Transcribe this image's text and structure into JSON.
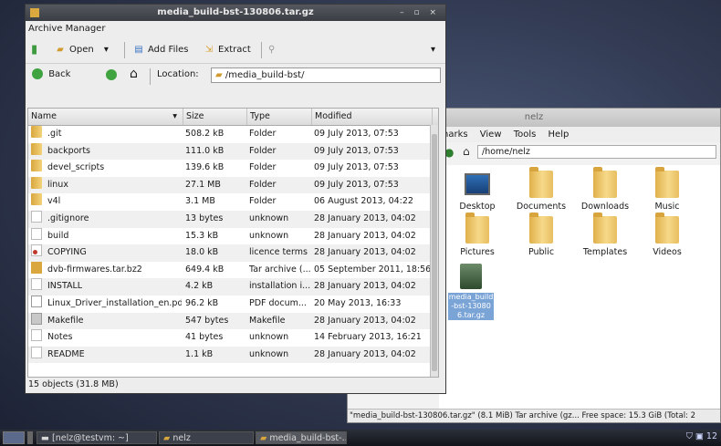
{
  "archive_window": {
    "title": "media_build-bst-130806.tar.gz",
    "window_controls": "– ▫ ×",
    "menu": "Archive Manager",
    "toolbar": {
      "open": "Open",
      "add_files": "Add Files",
      "extract": "Extract"
    },
    "nav": {
      "back": "Back",
      "location_label": "Location:",
      "location_value": "/media_build-bst/"
    },
    "columns": [
      "Name",
      "Size",
      "Type",
      "Modified"
    ],
    "rows": [
      {
        "name": ".git",
        "size": "508.2 kB",
        "type": "Folder",
        "modified": "09 July 2013, 07:53",
        "icon": "folder"
      },
      {
        "name": "backports",
        "size": "111.0 kB",
        "type": "Folder",
        "modified": "09 July 2013, 07:53",
        "icon": "folder"
      },
      {
        "name": "devel_scripts",
        "size": "139.6 kB",
        "type": "Folder",
        "modified": "09 July 2013, 07:53",
        "icon": "folder"
      },
      {
        "name": "linux",
        "size": "27.1 MB",
        "type": "Folder",
        "modified": "09 July 2013, 07:53",
        "icon": "folder"
      },
      {
        "name": "v4l",
        "size": "3.1 MB",
        "type": "Folder",
        "modified": "06 August 2013, 04:22",
        "icon": "folder"
      },
      {
        "name": ".gitignore",
        "size": "13 bytes",
        "type": "unknown",
        "modified": "28 January 2013, 04:02",
        "icon": "file"
      },
      {
        "name": "build",
        "size": "15.3 kB",
        "type": "unknown",
        "modified": "28 January 2013, 04:02",
        "icon": "file"
      },
      {
        "name": "COPYING",
        "size": "18.0 kB",
        "type": "licence terms",
        "modified": "28 January 2013, 04:02",
        "icon": "licence"
      },
      {
        "name": "dvb-firmwares.tar.bz2",
        "size": "649.4 kB",
        "type": "Tar archive (...",
        "modified": "05 September 2011, 18:56",
        "icon": "archive"
      },
      {
        "name": "INSTALL",
        "size": "4.2 kB",
        "type": "installation i...",
        "modified": "28 January 2013, 04:02",
        "icon": "file"
      },
      {
        "name": "Linux_Driver_installation_en.pdf",
        "size": "96.2 kB",
        "type": "PDF docum...",
        "modified": "20 May 2013, 16:33",
        "icon": "pdf"
      },
      {
        "name": "Makefile",
        "size": "547 bytes",
        "type": "Makefile",
        "modified": "28 January 2013, 04:02",
        "icon": "makefile"
      },
      {
        "name": "Notes",
        "size": "41 bytes",
        "type": "unknown",
        "modified": "14 February 2013, 16:21",
        "icon": "file"
      },
      {
        "name": "README",
        "size": "1.1 kB",
        "type": "unknown",
        "modified": "28 January 2013, 04:02",
        "icon": "file"
      }
    ],
    "status": "15 objects (31.8 MB)"
  },
  "file_manager": {
    "title": "nelz",
    "menu": [
      "harks",
      "View",
      "Tools",
      "Help"
    ],
    "location": "/home/nelz",
    "icons": [
      {
        "label": "Desktop",
        "kind": "desktop"
      },
      {
        "label": "Documents",
        "kind": "folder"
      },
      {
        "label": "Downloads",
        "kind": "folder"
      },
      {
        "label": "Music",
        "kind": "folder"
      },
      {
        "label": "Pictures",
        "kind": "folder"
      },
      {
        "label": "Public",
        "kind": "folder"
      },
      {
        "label": "Templates",
        "kind": "folder"
      },
      {
        "label": "Videos",
        "kind": "folder"
      },
      {
        "label": "media_build-bst-130806.tar.gz",
        "kind": "archive"
      }
    ],
    "status": "\"media_build-bst-130806.tar.gz\" (8.1 MiB) Tar archive (gz... Free space: 15.3 GiB (Total: 2"
  },
  "taskbar": {
    "tasks": [
      "[nelz@testvm: ~]",
      "nelz",
      "media_build-bst-..."
    ],
    "tray": "12"
  }
}
